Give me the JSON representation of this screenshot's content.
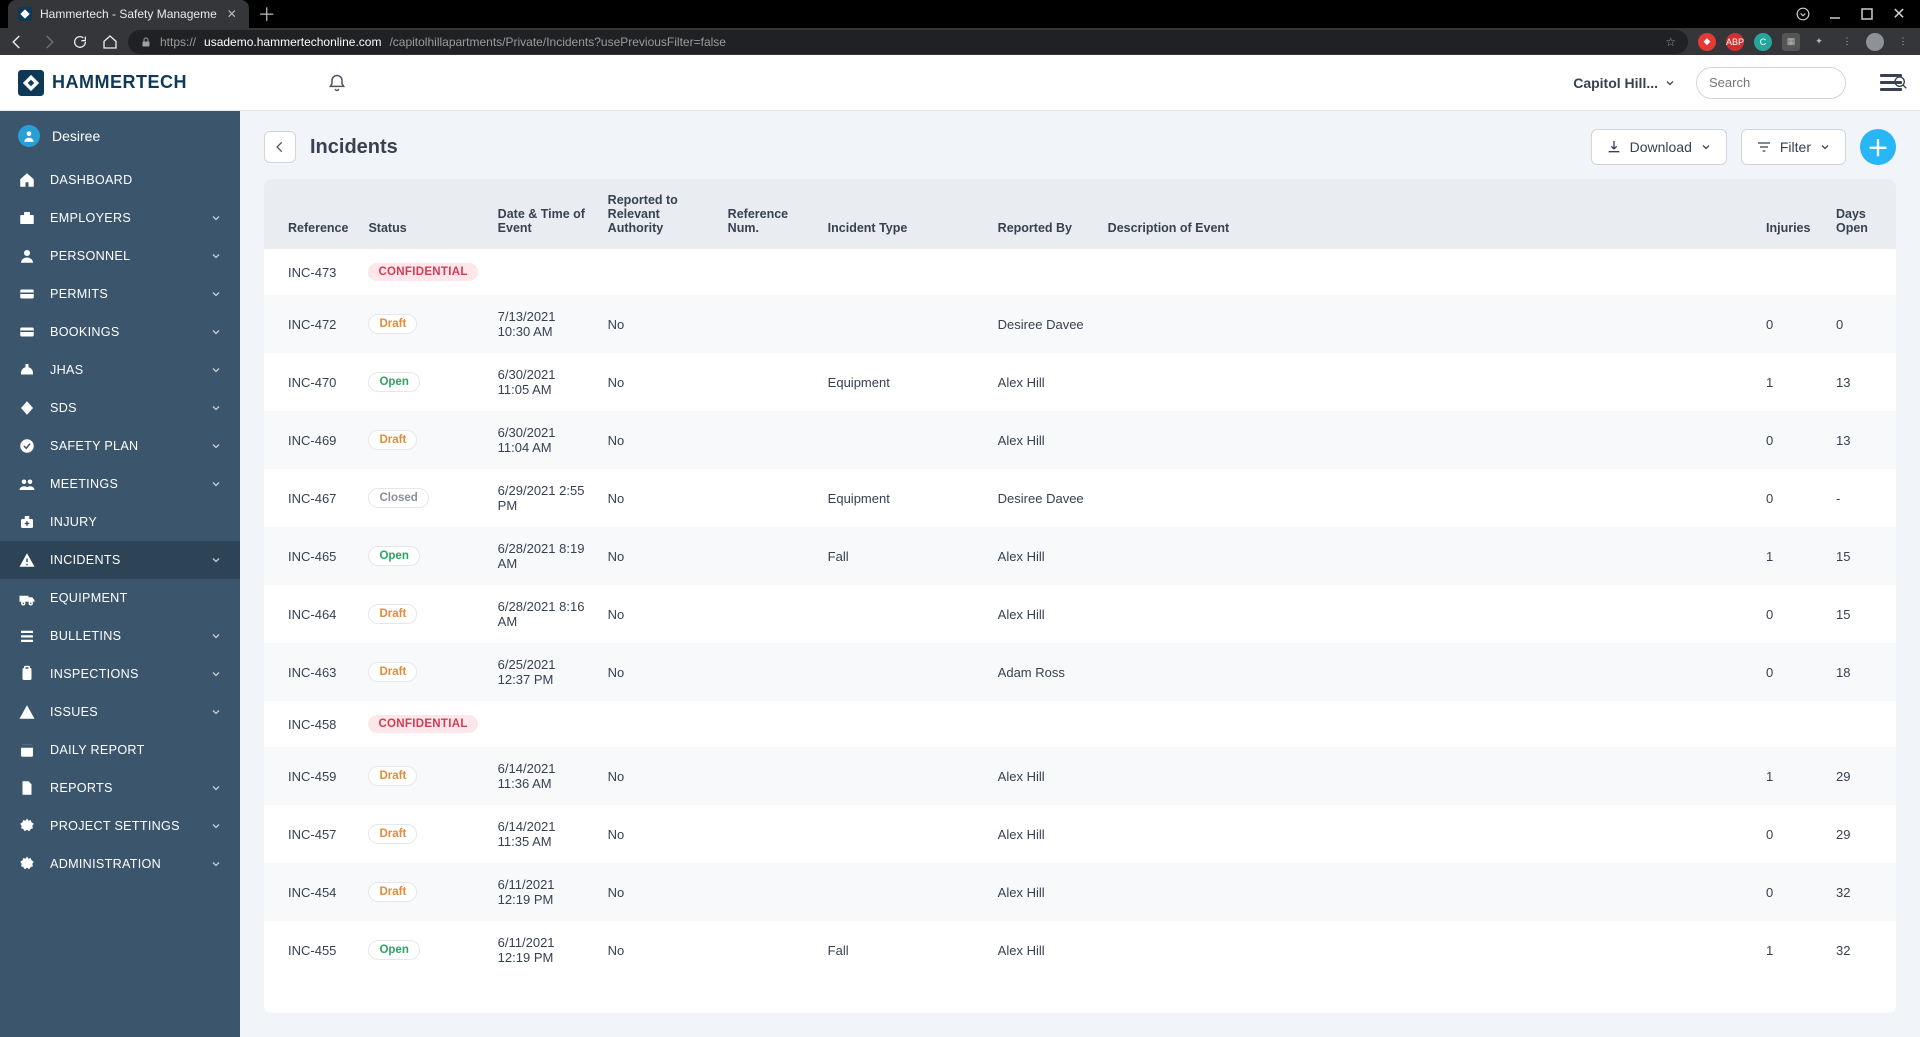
{
  "browser": {
    "tab_title": "Hammertech - Safety Manageme",
    "url_host": "usademo.hammertechonline.com",
    "url_path": "/capitolhillapartments/Private/Incidents?usePreviousFilter=false",
    "url_scheme": "https://"
  },
  "header": {
    "brand": "HAMMERTECH",
    "site_name": "Capitol Hill...",
    "search_placeholder": "Search"
  },
  "sidebar": {
    "user_name": "Desiree",
    "items": [
      {
        "label": "DASHBOARD",
        "icon": "home",
        "expandable": false,
        "active": false
      },
      {
        "label": "EMPLOYERS",
        "icon": "briefcase",
        "expandable": true,
        "active": false
      },
      {
        "label": "PERSONNEL",
        "icon": "person",
        "expandable": true,
        "active": false
      },
      {
        "label": "PERMITS",
        "icon": "card",
        "expandable": true,
        "active": false
      },
      {
        "label": "BOOKINGS",
        "icon": "card",
        "expandable": true,
        "active": false
      },
      {
        "label": "JHAS",
        "icon": "hardhat",
        "expandable": true,
        "active": false
      },
      {
        "label": "SDS",
        "icon": "diamond",
        "expandable": true,
        "active": false
      },
      {
        "label": "SAFETY PLAN",
        "icon": "checkcircle",
        "expandable": true,
        "active": false
      },
      {
        "label": "MEETINGS",
        "icon": "group",
        "expandable": true,
        "active": false
      },
      {
        "label": "INJURY",
        "icon": "medkit",
        "expandable": false,
        "active": false
      },
      {
        "label": "INCIDENTS",
        "icon": "warning",
        "expandable": true,
        "active": true
      },
      {
        "label": "EQUIPMENT",
        "icon": "truck",
        "expandable": false,
        "active": false
      },
      {
        "label": "BULLETINS",
        "icon": "list",
        "expandable": true,
        "active": false
      },
      {
        "label": "INSPECTIONS",
        "icon": "clipboard",
        "expandable": true,
        "active": false
      },
      {
        "label": "ISSUES",
        "icon": "alert",
        "expandable": true,
        "active": false
      },
      {
        "label": "DAILY REPORT",
        "icon": "calendar",
        "expandable": false,
        "active": false
      },
      {
        "label": "REPORTS",
        "icon": "doc",
        "expandable": true,
        "active": false
      },
      {
        "label": "PROJECT SETTINGS",
        "icon": "gear",
        "expandable": true,
        "active": false
      },
      {
        "label": "ADMINISTRATION",
        "icon": "gear",
        "expandable": true,
        "active": false
      }
    ]
  },
  "page": {
    "title": "Incidents",
    "download_label": "Download",
    "filter_label": "Filter"
  },
  "table": {
    "headers": {
      "reference": "Reference",
      "status": "Status",
      "date": "Date & Time of Event",
      "authority": "Reported to Relevant Authority",
      "refnum": "Reference Num.",
      "type": "Incident Type",
      "reported_by": "Reported By",
      "description": "Description of Event",
      "injuries": "Injuries",
      "days": "Days Open"
    },
    "rows": [
      {
        "reference": "INC-473",
        "status": "CONFIDENTIAL",
        "status_kind": "confidential",
        "date": "",
        "authority": "",
        "refnum": "",
        "type": "",
        "reported_by": "",
        "description": "",
        "injuries": "",
        "days": ""
      },
      {
        "reference": "INC-472",
        "status": "Draft",
        "status_kind": "draft",
        "date": "7/13/2021 10:30 AM",
        "authority": "No",
        "refnum": "",
        "type": "",
        "reported_by": "Desiree Davee",
        "description": "",
        "injuries": "0",
        "days": "0"
      },
      {
        "reference": "INC-470",
        "status": "Open",
        "status_kind": "open",
        "date": "6/30/2021 11:05 AM",
        "authority": "No",
        "refnum": "",
        "type": "Equipment",
        "reported_by": "Alex Hill",
        "description": "",
        "injuries": "1",
        "days": "13"
      },
      {
        "reference": "INC-469",
        "status": "Draft",
        "status_kind": "draft",
        "date": "6/30/2021 11:04 AM",
        "authority": "No",
        "refnum": "",
        "type": "",
        "reported_by": "Alex Hill",
        "description": "",
        "injuries": "0",
        "days": "13"
      },
      {
        "reference": "INC-467",
        "status": "Closed",
        "status_kind": "closed",
        "date": "6/29/2021 2:55 PM",
        "authority": "No",
        "refnum": "",
        "type": "Equipment",
        "reported_by": "Desiree Davee",
        "description": "",
        "injuries": "0",
        "days": "-"
      },
      {
        "reference": "INC-465",
        "status": "Open",
        "status_kind": "open",
        "date": "6/28/2021 8:19 AM",
        "authority": "No",
        "refnum": "",
        "type": "Fall",
        "reported_by": "Alex Hill",
        "description": "",
        "injuries": "1",
        "days": "15"
      },
      {
        "reference": "INC-464",
        "status": "Draft",
        "status_kind": "draft",
        "date": "6/28/2021 8:16 AM",
        "authority": "No",
        "refnum": "",
        "type": "",
        "reported_by": "Alex Hill",
        "description": "",
        "injuries": "0",
        "days": "15"
      },
      {
        "reference": "INC-463",
        "status": "Draft",
        "status_kind": "draft",
        "date": "6/25/2021 12:37 PM",
        "authority": "No",
        "refnum": "",
        "type": "",
        "reported_by": "Adam Ross",
        "description": "",
        "injuries": "0",
        "days": "18"
      },
      {
        "reference": "INC-458",
        "status": "CONFIDENTIAL",
        "status_kind": "confidential",
        "date": "",
        "authority": "",
        "refnum": "",
        "type": "",
        "reported_by": "",
        "description": "",
        "injuries": "",
        "days": ""
      },
      {
        "reference": "INC-459",
        "status": "Draft",
        "status_kind": "draft",
        "date": "6/14/2021 11:36 AM",
        "authority": "No",
        "refnum": "",
        "type": "",
        "reported_by": "Alex Hill",
        "description": "",
        "injuries": "1",
        "days": "29"
      },
      {
        "reference": "INC-457",
        "status": "Draft",
        "status_kind": "draft",
        "date": "6/14/2021 11:35 AM",
        "authority": "No",
        "refnum": "",
        "type": "",
        "reported_by": "Alex Hill",
        "description": "",
        "injuries": "0",
        "days": "29"
      },
      {
        "reference": "INC-454",
        "status": "Draft",
        "status_kind": "draft",
        "date": "6/11/2021 12:19 PM",
        "authority": "No",
        "refnum": "",
        "type": "",
        "reported_by": "Alex Hill",
        "description": "",
        "injuries": "0",
        "days": "32"
      },
      {
        "reference": "INC-455",
        "status": "Open",
        "status_kind": "open",
        "date": "6/11/2021 12:19 PM",
        "authority": "No",
        "refnum": "",
        "type": "Fall",
        "reported_by": "Alex Hill",
        "description": "",
        "injuries": "1",
        "days": "32"
      }
    ]
  }
}
